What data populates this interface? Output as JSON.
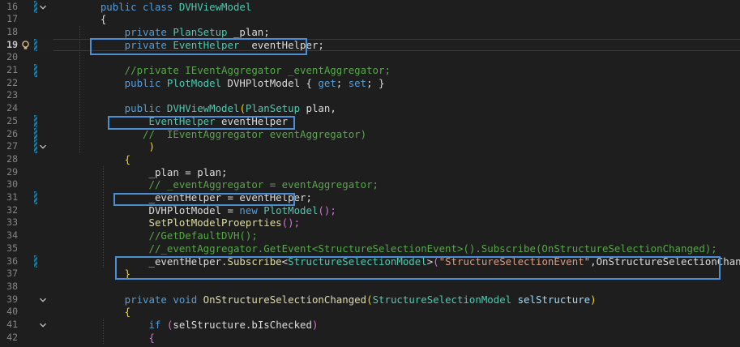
{
  "editor": {
    "lines": [
      {
        "num": "16",
        "fold": "open",
        "change": true,
        "tokens": [
          {
            "t": "    public class ",
            "c": "kw"
          },
          {
            "t": "DVHViewModel",
            "c": "type"
          }
        ]
      },
      {
        "num": "17",
        "fold": "",
        "change": false,
        "tokens": [
          {
            "t": "    {",
            "c": "pun"
          }
        ]
      },
      {
        "num": "18",
        "fold": "",
        "change": false,
        "tokens": [
          {
            "t": "        private ",
            "c": "kw"
          },
          {
            "t": "PlanSetup",
            "c": "type"
          },
          {
            "t": " _plan;",
            "c": "id"
          }
        ]
      },
      {
        "num": "19",
        "fold": "",
        "change": true,
        "current": true,
        "lightbulb": true,
        "tokens": [
          {
            "t": "        private ",
            "c": "kw"
          },
          {
            "t": "EventHelper",
            "c": "type"
          },
          {
            "t": " _eventHelper;",
            "c": "id"
          }
        ]
      },
      {
        "num": "20",
        "fold": "",
        "change": false,
        "tokens": []
      },
      {
        "num": "21",
        "fold": "",
        "change": true,
        "tokens": [
          {
            "t": "        //private IEventAggregator _eventAggregator;",
            "c": "com"
          }
        ]
      },
      {
        "num": "22",
        "fold": "",
        "change": false,
        "tokens": [
          {
            "t": "        public ",
            "c": "kw"
          },
          {
            "t": "PlotModel",
            "c": "type"
          },
          {
            "t": " DVHPlotModel ",
            "c": "id"
          },
          {
            "t": "{ ",
            "c": "pun"
          },
          {
            "t": "get",
            "c": "kw"
          },
          {
            "t": "; ",
            "c": "pun"
          },
          {
            "t": "set",
            "c": "kw"
          },
          {
            "t": "; }",
            "c": "pun"
          }
        ]
      },
      {
        "num": "23",
        "fold": "",
        "change": false,
        "tokens": []
      },
      {
        "num": "24",
        "fold": "",
        "change": false,
        "tokens": [
          {
            "t": "        public ",
            "c": "kw"
          },
          {
            "t": "DVHViewModel",
            "c": "type"
          },
          {
            "t": "(",
            "c": "br1"
          },
          {
            "t": "PlanSetup",
            "c": "type"
          },
          {
            "t": " plan,",
            "c": "id"
          }
        ]
      },
      {
        "num": "25",
        "fold": "",
        "change": true,
        "tokens": [
          {
            "t": "            ",
            "c": "id"
          },
          {
            "t": "EventHelper",
            "c": "type"
          },
          {
            "t": " eventHelper",
            "c": "id"
          }
        ]
      },
      {
        "num": "26",
        "fold": "",
        "change": true,
        "tokens": [
          {
            "t": "           //  IEventAggregator eventAggregator)",
            "c": "com"
          }
        ]
      },
      {
        "num": "27",
        "fold": "open",
        "change": true,
        "tokens": [
          {
            "t": "            ",
            "c": "id"
          },
          {
            "t": ")",
            "c": "br1"
          }
        ]
      },
      {
        "num": "28",
        "fold": "",
        "change": false,
        "tokens": [
          {
            "t": "        {",
            "c": "br1"
          }
        ]
      },
      {
        "num": "29",
        "fold": "",
        "change": false,
        "tokens": [
          {
            "t": "            _plan = plan;",
            "c": "id"
          }
        ]
      },
      {
        "num": "30",
        "fold": "",
        "change": false,
        "tokens": [
          {
            "t": "            // _eventAggregator = eventAggregator;",
            "c": "com"
          }
        ]
      },
      {
        "num": "31",
        "fold": "",
        "change": true,
        "tokens": [
          {
            "t": "            _eventHelper = eventHelper;",
            "c": "id"
          }
        ]
      },
      {
        "num": "32",
        "fold": "",
        "change": false,
        "tokens": [
          {
            "t": "            DVHPlotModel = ",
            "c": "id"
          },
          {
            "t": "new ",
            "c": "kw"
          },
          {
            "t": "PlotModel",
            "c": "type"
          },
          {
            "t": "();",
            "c": "br2"
          }
        ]
      },
      {
        "num": "33",
        "fold": "",
        "change": false,
        "tokens": [
          {
            "t": "            ",
            "c": "id"
          },
          {
            "t": "SetPlotModelProeprties",
            "c": "fn"
          },
          {
            "t": "();",
            "c": "br2"
          }
        ]
      },
      {
        "num": "34",
        "fold": "",
        "change": false,
        "tokens": [
          {
            "t": "            //GetDefaultDVH();",
            "c": "com"
          }
        ]
      },
      {
        "num": "35",
        "fold": "",
        "change": false,
        "tokens": [
          {
            "t": "            //_eventAggregator.GetEvent<StructureSelectionEvent>().Subscribe(OnStructureSelectionChanged);",
            "c": "com"
          }
        ]
      },
      {
        "num": "36",
        "fold": "",
        "change": true,
        "tokens": [
          {
            "t": "            _eventHelper.",
            "c": "id"
          },
          {
            "t": "Subscribe",
            "c": "fn"
          },
          {
            "t": "<",
            "c": "pun"
          },
          {
            "t": "StructureSelectionModel",
            "c": "type"
          },
          {
            "t": ">",
            "c": "pun"
          },
          {
            "t": "(",
            "c": "br2"
          },
          {
            "t": "\"StructureSelectionEvent\"",
            "c": "str"
          },
          {
            "t": ",OnStructureSelectionChanged",
            "c": "id"
          },
          {
            "t": ");",
            "c": "br2"
          }
        ]
      },
      {
        "num": "37",
        "fold": "",
        "change": false,
        "tokens": [
          {
            "t": "        }",
            "c": "br1"
          }
        ]
      },
      {
        "num": "38",
        "fold": "",
        "change": false,
        "tokens": []
      },
      {
        "num": "39",
        "fold": "open",
        "change": false,
        "tokens": [
          {
            "t": "        private ",
            "c": "kw"
          },
          {
            "t": "void ",
            "c": "kw"
          },
          {
            "t": "OnStructureSelectionChanged",
            "c": "fn"
          },
          {
            "t": "(",
            "c": "br1"
          },
          {
            "t": "StructureSelectionModel",
            "c": "type"
          },
          {
            "t": " selStructure",
            "c": "prm"
          },
          {
            "t": ")",
            "c": "br1"
          }
        ]
      },
      {
        "num": "40",
        "fold": "",
        "change": false,
        "tokens": [
          {
            "t": "        {",
            "c": "br1"
          }
        ]
      },
      {
        "num": "41",
        "fold": "open",
        "change": false,
        "tokens": [
          {
            "t": "            ",
            "c": "id"
          },
          {
            "t": "if ",
            "c": "kw"
          },
          {
            "t": "(",
            "c": "br2"
          },
          {
            "t": "selStructure.bIsChecked",
            "c": "id"
          },
          {
            "t": ")",
            "c": "br2"
          }
        ]
      },
      {
        "num": "42",
        "fold": "",
        "change": false,
        "tokens": [
          {
            "t": "            {",
            "c": "br2"
          }
        ]
      }
    ],
    "highlight_color": "#4a8fd6",
    "icons": {
      "lightbulb": "lightbulb-icon",
      "fold": "chevron-down-icon"
    }
  }
}
